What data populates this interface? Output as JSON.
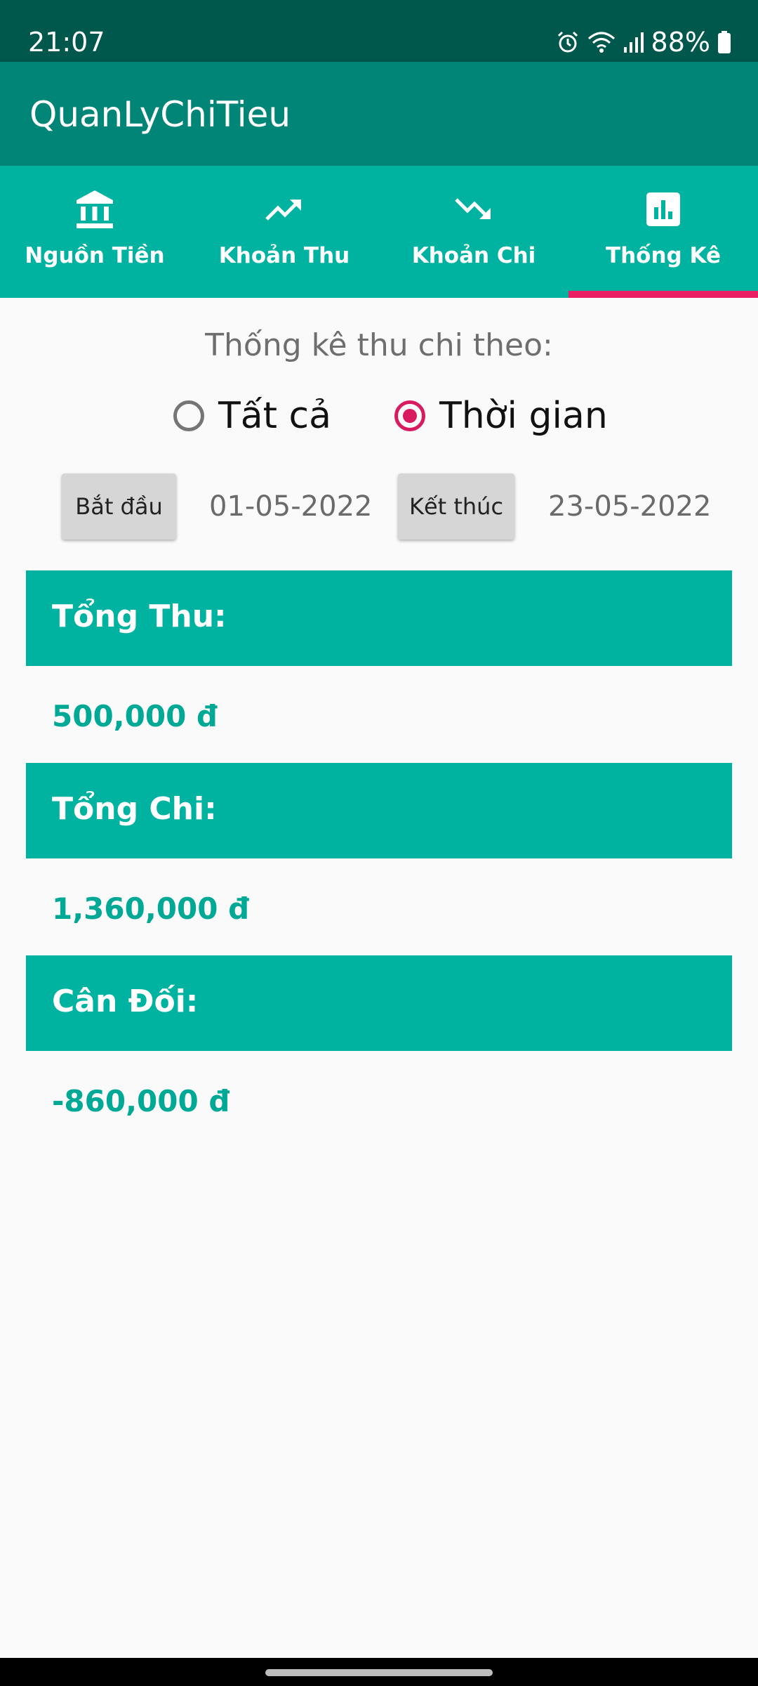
{
  "status_bar": {
    "time": "21:07",
    "battery": "88%",
    "icons": [
      "alarm-icon",
      "wifi-icon",
      "signal-icon",
      "battery-icon"
    ]
  },
  "app_bar": {
    "title": "QuanLyChiTieu"
  },
  "tabs": [
    {
      "label": "Nguồn Tiền",
      "icon": "bank-icon"
    },
    {
      "label": "Khoản Thu",
      "icon": "trending-up-icon"
    },
    {
      "label": "Khoản Chi",
      "icon": "trending-down-icon"
    },
    {
      "label": "Thống Kê",
      "icon": "bar-chart-icon",
      "selected": true
    }
  ],
  "filter": {
    "title": "Thống kê thu chi theo:",
    "options": [
      {
        "label": "Tất cả",
        "checked": false
      },
      {
        "label": "Thời gian",
        "checked": true
      }
    ]
  },
  "date_range": {
    "start_button": "Bắt đầu",
    "start_value": "01-05-2022",
    "end_button": "Kết thúc",
    "end_value": "23-05-2022"
  },
  "summary": {
    "income_label": "Tổng Thu:",
    "income_value": "500,000 đ",
    "expense_label": "Tổng Chi:",
    "expense_value": "1,360,000 đ",
    "balance_label": "Cân Đối:",
    "balance_value": "-860,000 đ"
  },
  "colors": {
    "status_bar": "#00574b",
    "app_bar": "#008577",
    "tab_bar": "#00b3a1",
    "accent": "#e91e63",
    "value_text": "#00a896"
  }
}
